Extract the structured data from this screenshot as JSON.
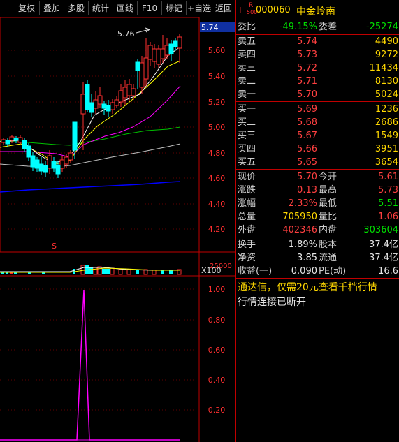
{
  "toolbar": {
    "buttons": [
      "复权",
      "叠加",
      "多股",
      "统计",
      "画线",
      "F10",
      "标记",
      "+自选",
      "返回"
    ]
  },
  "chart": {
    "price_axis": [
      "5.74",
      "5.60",
      "5.40",
      "5.20",
      "5.00",
      "4.80",
      "4.60",
      "4.40",
      "4.20"
    ],
    "current_price_tag": "5.74",
    "high_annotation": "5.76",
    "volume_axis_label": "X100",
    "volume_tick": "25000",
    "marker": "S",
    "indicator_axis": [
      "1.00",
      "0.80",
      "0.60",
      "0.40",
      "0.20"
    ],
    "colors": {
      "up": "#ff4040",
      "down": "#00ffff",
      "ma5": "#ffffff",
      "ma10": "#ffff00",
      "ma20": "#ff00ff",
      "ma30": "#00c000",
      "ma60": "#0000ff",
      "ma120": "#c0c0c0",
      "indicator": "#ff00ff"
    }
  },
  "quote": {
    "flag_L": "L",
    "flag_R": "R",
    "flag_num": "500",
    "code": "000060",
    "name": "中金岭南",
    "weibi_label": "委比",
    "weibi_value": "-49.15%",
    "weicha_label": "委差",
    "weicha_value": "-25274",
    "asks": [
      {
        "label": "卖五",
        "price": "5.74",
        "vol": "4490"
      },
      {
        "label": "卖四",
        "price": "5.73",
        "vol": "9272"
      },
      {
        "label": "卖三",
        "price": "5.72",
        "vol": "11434"
      },
      {
        "label": "卖二",
        "price": "5.71",
        "vol": "8130"
      },
      {
        "label": "卖一",
        "price": "5.70",
        "vol": "5024"
      }
    ],
    "bids": [
      {
        "label": "买一",
        "price": "5.69",
        "vol": "1236"
      },
      {
        "label": "买二",
        "price": "5.68",
        "vol": "2686"
      },
      {
        "label": "买三",
        "price": "5.67",
        "vol": "1549"
      },
      {
        "label": "买四",
        "price": "5.66",
        "vol": "3951"
      },
      {
        "label": "买五",
        "price": "5.65",
        "vol": "3654"
      }
    ],
    "stats": [
      {
        "l1": "现价",
        "v1": "5.70",
        "l2": "今开",
        "v2": "5.61"
      },
      {
        "l1": "涨跌",
        "v1": "0.13",
        "l2": "最高",
        "v2": "5.73"
      },
      {
        "l1": "涨幅",
        "v1": "2.33%",
        "l2": "最低",
        "v2": "5.51"
      },
      {
        "l1": "总量",
        "v1": "705950",
        "l2": "量比",
        "v2": "1.06"
      },
      {
        "l1": "外盘",
        "v1": "402346",
        "l2": "内盘",
        "v2": "303604"
      }
    ],
    "stats2": [
      {
        "l1": "换手",
        "v1": "1.89%",
        "l2": "股本",
        "v2": "37.4亿"
      },
      {
        "l1": "净资",
        "v1": "3.85",
        "l2": "流通",
        "v2": "37.4亿"
      },
      {
        "l1": "收益(一)",
        "v1": "0.090",
        "l2": "PE(动)",
        "v2": "16.6"
      }
    ],
    "notice1": "通达信，仅需20元查看千档行情",
    "notice2": "行情连接已断开"
  }
}
